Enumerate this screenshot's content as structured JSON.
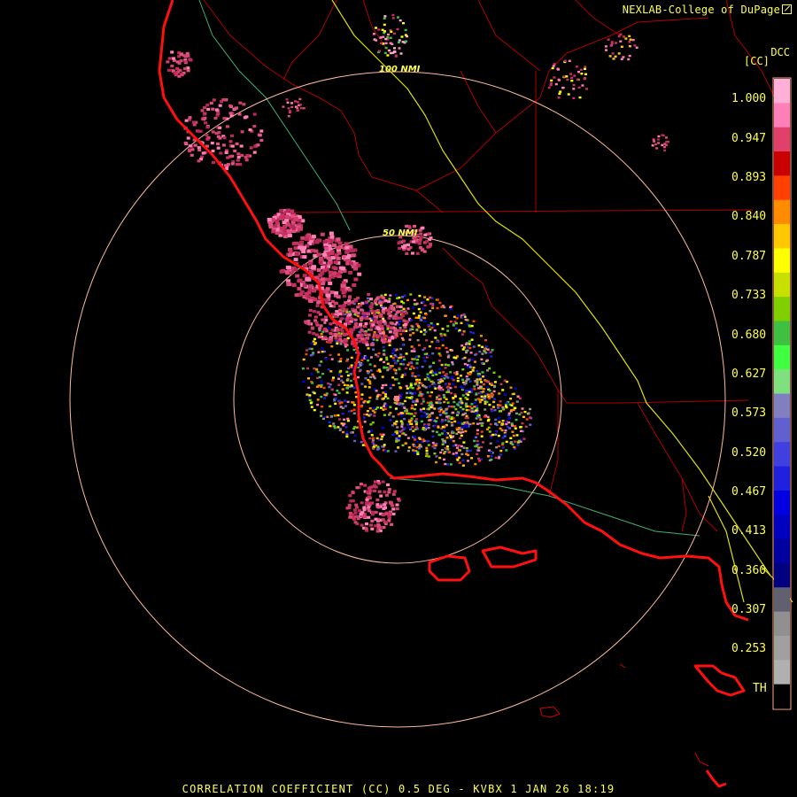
{
  "header": {
    "credit": "NEXLAB-College of DuPage",
    "product_code": "DCC",
    "unit": "[CC]"
  },
  "rings": {
    "inner_label": "50 NMI",
    "outer_label": "100 NMI"
  },
  "color_scale": {
    "labels": [
      "1.000",
      "0.947",
      "0.893",
      "0.840",
      "0.787",
      "0.733",
      "0.680",
      "0.627",
      "0.573",
      "0.520",
      "0.467",
      "0.413",
      "0.360",
      "0.307",
      "0.253",
      "TH"
    ],
    "colors": [
      "#ffb0d8",
      "#ff7fb8",
      "#e0406a",
      "#c80000",
      "#ff4000",
      "#ff8c00",
      "#ffc800",
      "#ffff00",
      "#c8e000",
      "#80d000",
      "#40c040",
      "#40ff40",
      "#80e080",
      "#8080c0",
      "#6060d0",
      "#4040e0",
      "#2020e0",
      "#0000e0",
      "#0000c0",
      "#0000a0",
      "#000080",
      "#606070",
      "#909090",
      "#a0a0a0",
      "#b0b0b0",
      "#000000"
    ]
  },
  "footer": {
    "caption": "CORRELATION COEFFICIENT (CC) 0.5 DEG - KVBX 1 JAN 26 18:19"
  },
  "map_colors": {
    "background": "#000000",
    "coast": "#ff0000",
    "state_border": "#cc0000",
    "county": "#cc0000",
    "highway": "#ffff00",
    "river": "#40c080",
    "range_ring": "#ffbb99"
  }
}
